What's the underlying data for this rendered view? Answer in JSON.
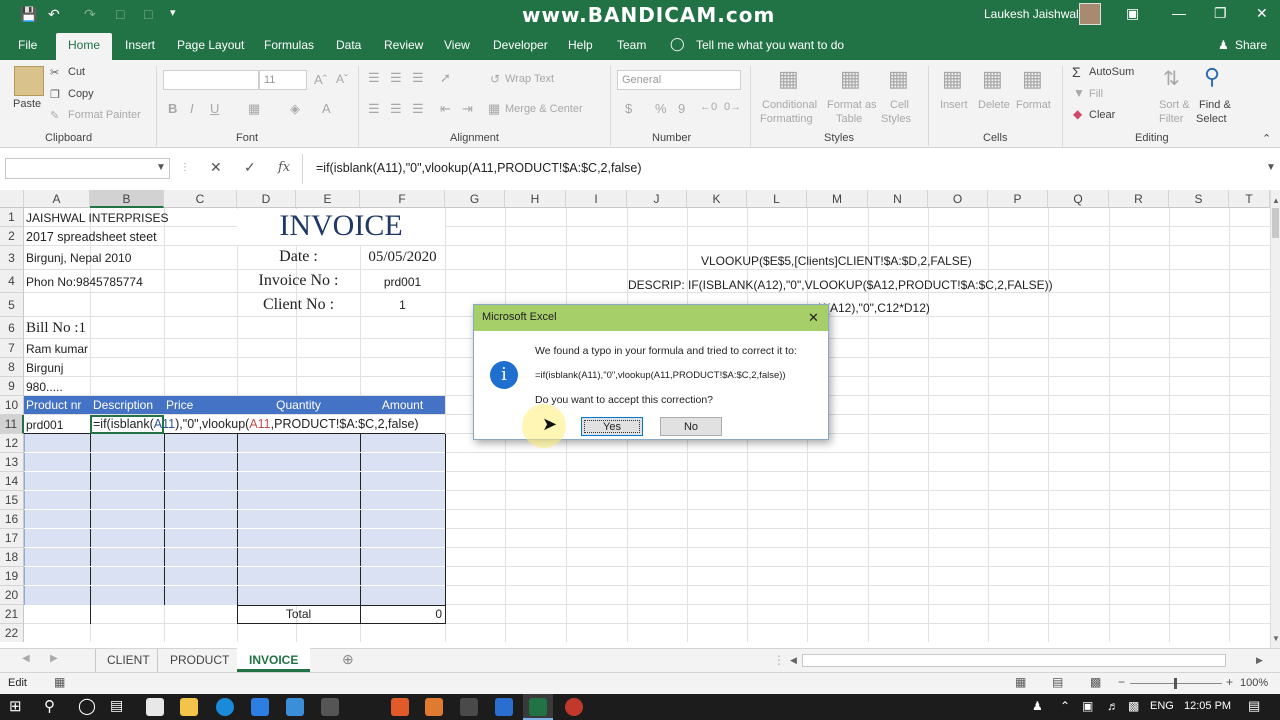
{
  "titlebar": {
    "watermark": "www.BANDICAM.com",
    "user": "Laukesh Jaishwal",
    "accent": "#217346"
  },
  "ribbon_tabs": [
    "File",
    "Home",
    "Insert",
    "Page Layout",
    "Formulas",
    "Data",
    "Review",
    "View",
    "Developer",
    "Help",
    "Team"
  ],
  "tell_me": "Tell me what you want to do",
  "share": "Share",
  "clipboard": {
    "paste": "Paste",
    "cut": "Cut",
    "copy": "Copy",
    "format_painter": "Format Painter",
    "group": "Clipboard"
  },
  "font": {
    "size": "11",
    "group": "Font"
  },
  "alignment": {
    "wrap": "Wrap Text",
    "merge": "Merge & Center",
    "group": "Alignment"
  },
  "number": {
    "format": "General",
    "group": "Number"
  },
  "styles": {
    "cond": "Conditional",
    "cond2": "Formatting",
    "fmt_table": "Format as",
    "fmt_table2": "Table",
    "cell_styles": "Cell",
    "cell_styles2": "Styles",
    "group": "Styles"
  },
  "cells": {
    "insert": "Insert",
    "delete": "Delete",
    "format": "Format",
    "group": "Cells"
  },
  "editing": {
    "autosum": "AutoSum",
    "fill": "Fill",
    "clear": "Clear",
    "sort": "Sort &",
    "sort2": "Filter",
    "find": "Find &",
    "find2": "Select",
    "group": "Editing"
  },
  "formula_bar": {
    "fx": "fx",
    "formula": "=if(isblank(A11),\"0\",vlookup(A11,PRODUCT!$A:$C,2,false)"
  },
  "columns": [
    "A",
    "B",
    "C",
    "D",
    "E",
    "F",
    "G",
    "H",
    "I",
    "J",
    "K",
    "L",
    "M",
    "N",
    "O",
    "P",
    "Q",
    "R",
    "S",
    "T"
  ],
  "rows": [
    "1",
    "2",
    "3",
    "4",
    "5",
    "6",
    "7",
    "8",
    "9",
    "10",
    "11",
    "12",
    "13",
    "14",
    "15",
    "16",
    "17",
    "18",
    "19",
    "20",
    "21",
    "22"
  ],
  "cells_data": {
    "a1": "JAISHWAL INTERPRISES",
    "a2": "2017 spreadsheet steet",
    "a3": "Birgunj, Nepal 2010",
    "a4": "Phon No:9845785774",
    "invoice_title": "INVOICE",
    "date_label": "Date   :",
    "date_value": "05/05/2020",
    "invoice_no_label": "Invoice No :",
    "invoice_no_value": "prd001",
    "client_no_label": "Client No :",
    "client_no_value": "1",
    "bill_no": "Bill No :1",
    "a7": "Ram kumar",
    "a8": "Birgunj",
    "a9": "980.....",
    "h_product": "Product nr",
    "h_description": "Description",
    "h_price": "Price",
    "h_quantity": "Quantity",
    "h_amount": "Amount",
    "a11": "prd001",
    "b11_part1": "=if(isblank(",
    "b11_ref1": "A11",
    "b11_part2": "),\"0\",vlookup(",
    "b11_ref2": "A11",
    "b11_part3": ",PRODUCT!$A:$C,2,false)",
    "total_label": "Total",
    "total_value": "0",
    "note1": "VLOOKUP($E$5,[Clients]CLIENT!$A:$D,2,FALSE)",
    "note2": "DESCRIP: IF(ISBLANK(A12),\"0\",VLOOKUP($A12,PRODUCT!$A:$C,2,FALSE))",
    "note3": "K(A12),\"0\",C12*D12)"
  },
  "dialog": {
    "title": "Microsoft Excel",
    "line1": "We found a typo in your formula and tried to correct it to:",
    "line2": "=if(isblank(A11),\"0\",vlookup(A11,PRODUCT!$A:$C,2,false))",
    "line3": "Do you want to accept this correction?",
    "yes": "Yes",
    "no": "No"
  },
  "sheets": [
    "CLIENT",
    "PRODUCT",
    "INVOICE"
  ],
  "status": {
    "mode": "Edit",
    "zoom": "100%"
  },
  "taskbar": {
    "lang": "ENG",
    "time": "12:05 PM"
  }
}
